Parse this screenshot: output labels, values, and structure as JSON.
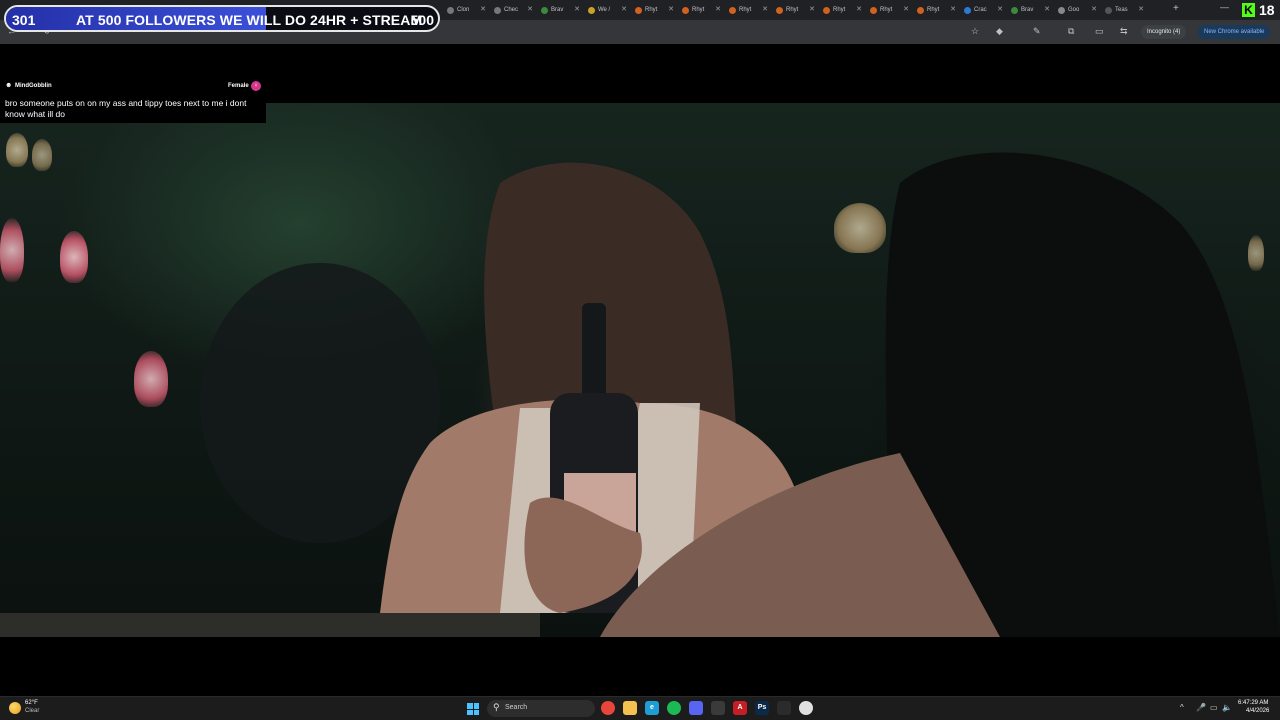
{
  "follower_goal": {
    "current": "301",
    "text": "AT 500 FOLLOWERS WE WILL DO 24HR + STREAM",
    "target": "500",
    "progress": 0.602
  },
  "kick": {
    "logo": "K",
    "count": "18"
  },
  "browser": {
    "tabs": [
      {
        "label": "Clon",
        "icon": "page-icon"
      },
      {
        "label": "Chec",
        "icon": "page-icon"
      },
      {
        "label": "Brav",
        "icon": "globe-icon"
      },
      {
        "label": "We /",
        "icon": "page-icon"
      },
      {
        "label": "Rhyt",
        "icon": "page-icon"
      },
      {
        "label": "Rhyt",
        "icon": "page-icon"
      },
      {
        "label": "Rhyt",
        "icon": "page-icon"
      },
      {
        "label": "Rhyt",
        "icon": "page-icon"
      },
      {
        "label": "Rhyt",
        "icon": "page-icon"
      },
      {
        "label": "Rhyt",
        "icon": "page-icon"
      },
      {
        "label": "Rhyt",
        "icon": "page-icon"
      },
      {
        "label": "Crac",
        "icon": "page-icon"
      },
      {
        "label": "Brav",
        "icon": "globe-icon"
      },
      {
        "label": "Goo",
        "icon": "page-icon"
      },
      {
        "label": "Teas",
        "icon": "page-icon"
      }
    ],
    "incognito_label": "Incognito (4)",
    "new_chrome_label": "New Chrome available"
  },
  "chat": {
    "username": "MindGobblin",
    "gender_label": "Female",
    "message": "bro someone puts on on my ass and tippy toes next to me i dont know what ill do"
  },
  "taskbar": {
    "weather_temp": "62°F",
    "weather_cond": "Clear",
    "search_placeholder": "Search",
    "time": "6:47:29 AM",
    "date": "4/4/2026",
    "apps": [
      {
        "name": "chrome-icon",
        "color": "#e8453c"
      },
      {
        "name": "file-explorer-icon",
        "color": "#f2c14e"
      },
      {
        "name": "edge-icon",
        "color": "#1f9ed6"
      },
      {
        "name": "spotify-icon",
        "color": "#1db954"
      },
      {
        "name": "discord-icon",
        "color": "#5865f2"
      },
      {
        "name": "obs-icon",
        "color": "#3a3a3a"
      },
      {
        "name": "acrobat-icon",
        "color": "#c51f25"
      },
      {
        "name": "photoshop-icon",
        "color": "#0b2a4a"
      },
      {
        "name": "terminal-icon",
        "color": "#2b2b2b"
      },
      {
        "name": "app-icon",
        "color": "#e0e0e0"
      }
    ]
  }
}
